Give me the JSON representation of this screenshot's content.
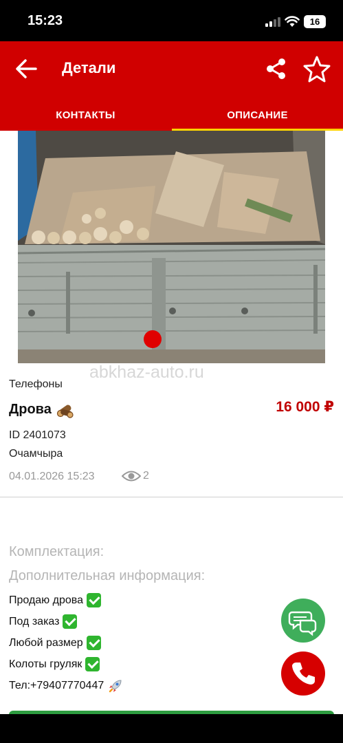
{
  "status": {
    "time": "15:23",
    "battery": "16"
  },
  "appbar": {
    "title": "Детали"
  },
  "tabs": [
    {
      "label": "КОНТАКТЫ"
    },
    {
      "label": "ОПИСАНИЕ"
    }
  ],
  "watermark": "abkhaz-auto.ru",
  "listing": {
    "phones_label": "Телефоны",
    "title": "Дрова",
    "price": "16 000 ₽",
    "id": "ID 2401073",
    "city": "Очамчыра",
    "date": "04.01.2026 15:23",
    "views": "2"
  },
  "description": {
    "equipment_label": "Комплектация:",
    "additional_label": "Дополнительная информация:",
    "lines": [
      "Продаю дрова",
      "Под заказ",
      "Любой размер",
      "Колоты груляк",
      "Тел:+79407770447"
    ]
  },
  "colors": {
    "brand": "#d00000",
    "tab_indicator": "#ffd400",
    "price": "#c00000",
    "chat": "#3fae5b",
    "call": "#d60000"
  }
}
